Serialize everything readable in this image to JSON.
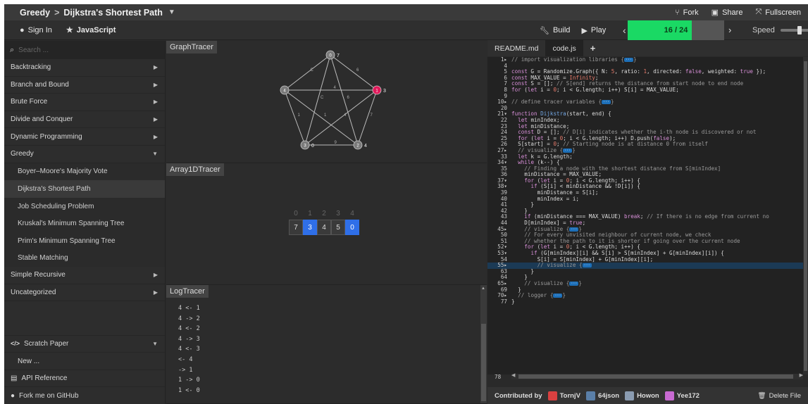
{
  "header": {
    "breadcrumb_category": "Greedy",
    "breadcrumb_separator": ">",
    "breadcrumb_algorithm": "Dijkstra's Shortest Path",
    "fork_label": "Fork",
    "share_label": "Share",
    "fullscreen_label": "Fullscreen"
  },
  "toolbar": {
    "sign_in_label": "Sign In",
    "language_label": "JavaScript",
    "build_label": "Build",
    "play_label": "Play",
    "progress_text": "16 / 24",
    "progress_fraction": 0.667,
    "speed_label": "Speed",
    "speed_fraction": 0.55
  },
  "sidebar": {
    "search_placeholder": "Search ...",
    "categories": [
      {
        "label": "Backtracking"
      },
      {
        "label": "Branch and Bound"
      },
      {
        "label": "Brute Force"
      },
      {
        "label": "Divide and Conquer"
      },
      {
        "label": "Dynamic Programming"
      },
      {
        "label": "Greedy"
      }
    ],
    "greedy_items": [
      {
        "label": "Boyer–Moore's Majority Vote"
      },
      {
        "label": "Dijkstra's Shortest Path"
      },
      {
        "label": "Job Scheduling Problem"
      },
      {
        "label": "Kruskal's Minimum Spanning Tree"
      },
      {
        "label": "Prim's Minimum Spanning Tree"
      },
      {
        "label": "Stable Matching"
      }
    ],
    "more_categories": [
      {
        "label": "Simple Recursive"
      },
      {
        "label": "Uncategorized"
      }
    ],
    "scratch_paper_label": "Scratch Paper",
    "new_label": "New ...",
    "api_reference_label": "API Reference",
    "github_label": "Fork me on GitHub"
  },
  "graph_tracer": {
    "title": "GraphTracer",
    "nodes": [
      {
        "id": "0",
        "dist": "7",
        "selected": false
      },
      {
        "id": "1",
        "dist": "3",
        "selected": true
      },
      {
        "id": "2",
        "dist": "4",
        "selected": false
      },
      {
        "id": "3",
        "dist": "0",
        "selected": false
      },
      {
        "id": "4",
        "dist": "",
        "selected": false
      }
    ],
    "edge_weights": [
      "6",
      "6",
      "C",
      "C",
      "7",
      "4",
      "4",
      "9",
      "1",
      "1",
      "C"
    ]
  },
  "array_tracer": {
    "title": "Array1DTracer",
    "indices": [
      "0",
      "1",
      "2",
      "3",
      "4"
    ],
    "values": [
      "7",
      "3",
      "4",
      "5",
      "0"
    ],
    "selected": [
      false,
      true,
      false,
      false,
      true
    ]
  },
  "log_tracer": {
    "title": "LogTracer",
    "lines": [
      "4 <- 1",
      "4 -> 2",
      "4 <- 2",
      "4 -> 3",
      "4 <- 3",
      "<- 4",
      "-> 1",
      "1 -> 0",
      "1 <- 0"
    ]
  },
  "editor": {
    "tabs": [
      {
        "label": "README.md"
      },
      {
        "label": "code.js"
      }
    ],
    "add_tab": "+",
    "last_line_number": "78",
    "footer_label": "Contributed by",
    "contributors": [
      {
        "name": "TornjV",
        "color": "#d94040"
      },
      {
        "name": "64json",
        "color": "#5a7fa8"
      },
      {
        "name": "Howon",
        "color": "#8a9bb0"
      },
      {
        "name": "Yee172",
        "color": "#c86ad2"
      }
    ],
    "delete_label": "Delete File"
  }
}
